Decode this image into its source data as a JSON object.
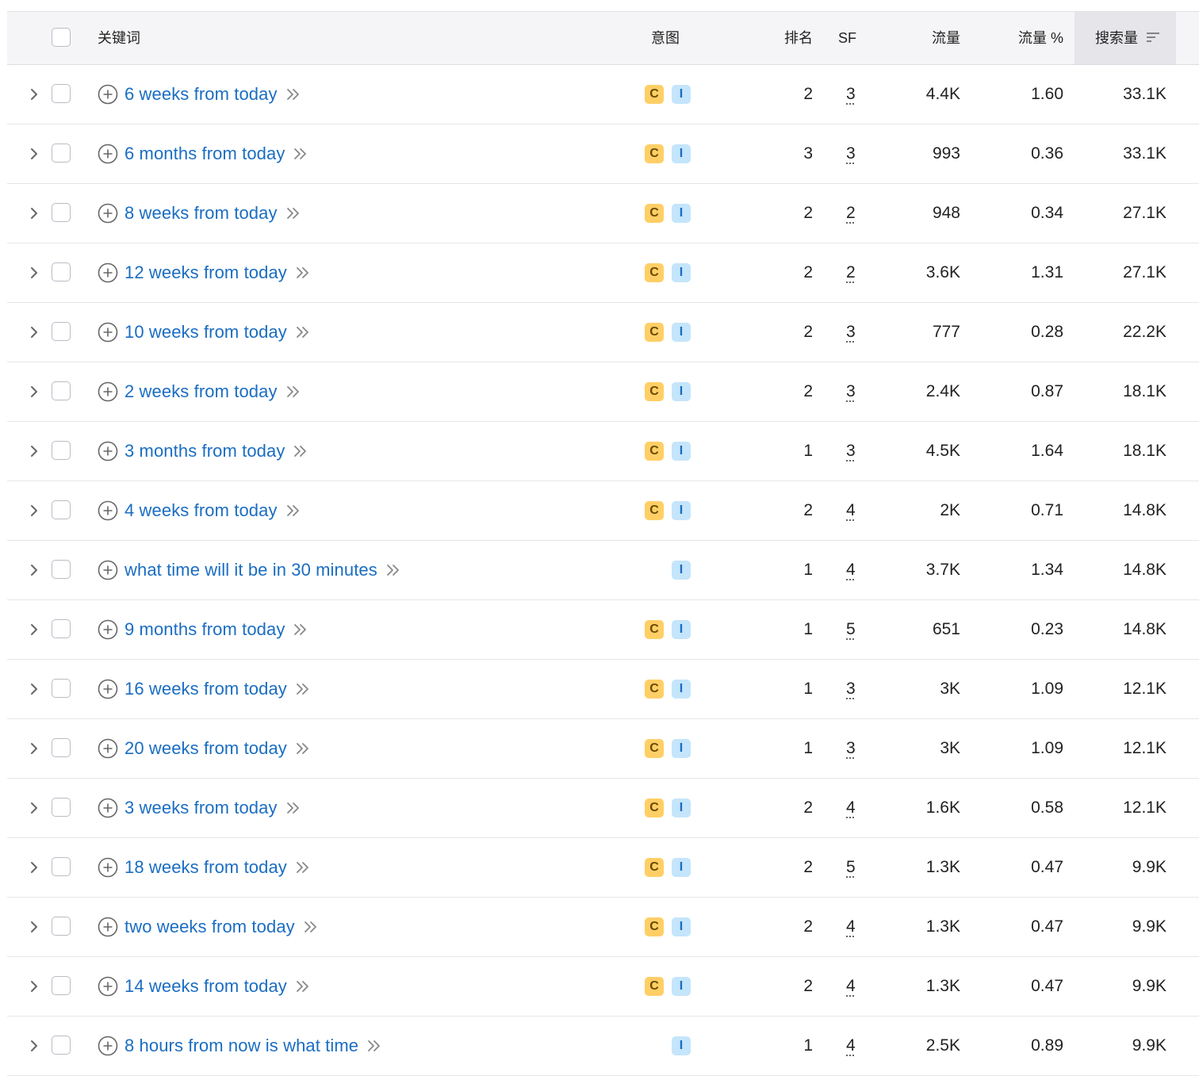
{
  "table": {
    "columns": {
      "keyword": "关键词",
      "intent": "意图",
      "rank": "排名",
      "sf": "SF",
      "traffic": "流量",
      "traffic_pct": "流量 %",
      "volume": "搜索量"
    },
    "sorted_column": "volume",
    "colors": {
      "link": "#1a6dc2",
      "intent_c": "#ffcf66",
      "intent_i": "#c4e5fb",
      "header_bg": "#f5f5f7"
    },
    "rows": [
      {
        "keyword": "6 weeks from today",
        "intents": [
          "C",
          "I"
        ],
        "rank": "2",
        "sf": "3",
        "traffic": "4.4K",
        "traffic_pct": "1.60",
        "volume": "33.1K"
      },
      {
        "keyword": "6 months from today",
        "intents": [
          "C",
          "I"
        ],
        "rank": "3",
        "sf": "3",
        "traffic": "993",
        "traffic_pct": "0.36",
        "volume": "33.1K"
      },
      {
        "keyword": "8 weeks from today",
        "intents": [
          "C",
          "I"
        ],
        "rank": "2",
        "sf": "2",
        "traffic": "948",
        "traffic_pct": "0.34",
        "volume": "27.1K"
      },
      {
        "keyword": "12 weeks from today",
        "intents": [
          "C",
          "I"
        ],
        "rank": "2",
        "sf": "2",
        "traffic": "3.6K",
        "traffic_pct": "1.31",
        "volume": "27.1K"
      },
      {
        "keyword": "10 weeks from today",
        "intents": [
          "C",
          "I"
        ],
        "rank": "2",
        "sf": "3",
        "traffic": "777",
        "traffic_pct": "0.28",
        "volume": "22.2K"
      },
      {
        "keyword": "2 weeks from today",
        "intents": [
          "C",
          "I"
        ],
        "rank": "2",
        "sf": "3",
        "traffic": "2.4K",
        "traffic_pct": "0.87",
        "volume": "18.1K"
      },
      {
        "keyword": "3 months from today",
        "intents": [
          "C",
          "I"
        ],
        "rank": "1",
        "sf": "3",
        "traffic": "4.5K",
        "traffic_pct": "1.64",
        "volume": "18.1K"
      },
      {
        "keyword": "4 weeks from today",
        "intents": [
          "C",
          "I"
        ],
        "rank": "2",
        "sf": "4",
        "traffic": "2K",
        "traffic_pct": "0.71",
        "volume": "14.8K"
      },
      {
        "keyword": "what time will it be in 30 minutes",
        "intents": [
          "I"
        ],
        "rank": "1",
        "sf": "4",
        "traffic": "3.7K",
        "traffic_pct": "1.34",
        "volume": "14.8K"
      },
      {
        "keyword": "9 months from today",
        "intents": [
          "C",
          "I"
        ],
        "rank": "1",
        "sf": "5",
        "traffic": "651",
        "traffic_pct": "0.23",
        "volume": "14.8K"
      },
      {
        "keyword": "16 weeks from today",
        "intents": [
          "C",
          "I"
        ],
        "rank": "1",
        "sf": "3",
        "traffic": "3K",
        "traffic_pct": "1.09",
        "volume": "12.1K"
      },
      {
        "keyword": "20 weeks from today",
        "intents": [
          "C",
          "I"
        ],
        "rank": "1",
        "sf": "3",
        "traffic": "3K",
        "traffic_pct": "1.09",
        "volume": "12.1K"
      },
      {
        "keyword": "3 weeks from today",
        "intents": [
          "C",
          "I"
        ],
        "rank": "2",
        "sf": "4",
        "traffic": "1.6K",
        "traffic_pct": "0.58",
        "volume": "12.1K"
      },
      {
        "keyword": "18 weeks from today",
        "intents": [
          "C",
          "I"
        ],
        "rank": "2",
        "sf": "5",
        "traffic": "1.3K",
        "traffic_pct": "0.47",
        "volume": "9.9K"
      },
      {
        "keyword": "two weeks from today",
        "intents": [
          "C",
          "I"
        ],
        "rank": "2",
        "sf": "4",
        "traffic": "1.3K",
        "traffic_pct": "0.47",
        "volume": "9.9K"
      },
      {
        "keyword": "14 weeks from today",
        "intents": [
          "C",
          "I"
        ],
        "rank": "2",
        "sf": "4",
        "traffic": "1.3K",
        "traffic_pct": "0.47",
        "volume": "9.9K"
      },
      {
        "keyword": "8 hours from now is what time",
        "intents": [
          "I"
        ],
        "rank": "1",
        "sf": "4",
        "traffic": "2.5K",
        "traffic_pct": "0.89",
        "volume": "9.9K"
      }
    ]
  }
}
